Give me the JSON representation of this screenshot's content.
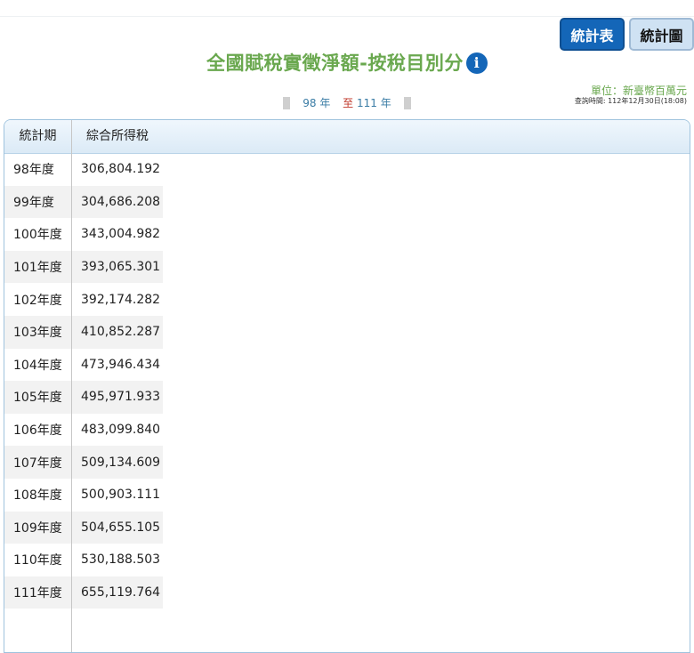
{
  "buttons": {
    "table": "統計表",
    "chart": "統計圖"
  },
  "title": "全國賦稅實徵淨額-按稅目別分",
  "info_icon": "i",
  "range": {
    "start": "98",
    "start_unit": "年",
    "to": "至",
    "end": "111",
    "end_unit": "年"
  },
  "unit": "單位：新臺幣百萬元",
  "query_time": "查詢時間: 112年12月30日(18:08)",
  "table": {
    "headers": [
      "統計期",
      "綜合所得稅"
    ],
    "rows": [
      [
        "98年度",
        "306,804.192"
      ],
      [
        "99年度",
        "304,686.208"
      ],
      [
        "100年度",
        "343,004.982"
      ],
      [
        "101年度",
        "393,065.301"
      ],
      [
        "102年度",
        "392,174.282"
      ],
      [
        "103年度",
        "410,852.287"
      ],
      [
        "104年度",
        "473,946.434"
      ],
      [
        "105年度",
        "495,971.933"
      ],
      [
        "106年度",
        "483,099.840"
      ],
      [
        "107年度",
        "509,134.609"
      ],
      [
        "108年度",
        "500,903.111"
      ],
      [
        "109年度",
        "504,655.105"
      ],
      [
        "110年度",
        "530,188.503"
      ],
      [
        "111年度",
        "655,119.764"
      ]
    ]
  },
  "colors": {
    "accent": "#1466b8",
    "title": "#6aa84f",
    "header": "#dbeaf6"
  }
}
